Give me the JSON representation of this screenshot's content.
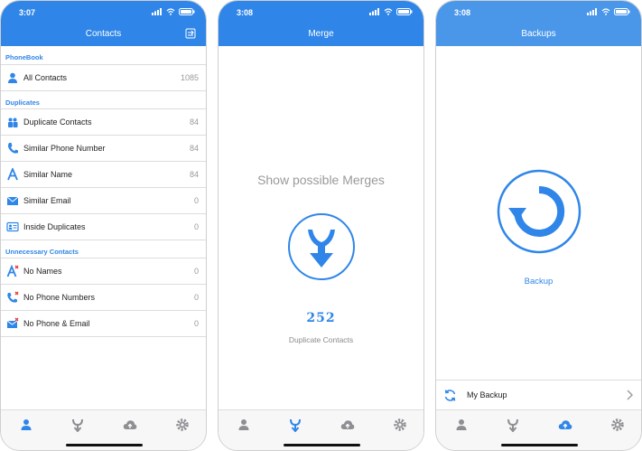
{
  "colors": {
    "accent": "#2f86e8",
    "accent_light": "#4a97ea",
    "tab_inactive": "#8e8e93"
  },
  "screen1": {
    "time": "3:07",
    "title": "Contacts",
    "sections": [
      {
        "header": "PhoneBook",
        "rows": [
          {
            "label": "All Contacts",
            "count": "1085",
            "icon": "person-icon"
          }
        ]
      },
      {
        "header": "Duplicates",
        "rows": [
          {
            "label": "Duplicate Contacts",
            "count": "84",
            "icon": "duplicate-people-icon"
          },
          {
            "label": "Similar Phone Number",
            "count": "84",
            "icon": "phone-icon"
          },
          {
            "label": "Similar Name",
            "count": "84",
            "icon": "letter-a-icon"
          },
          {
            "label": "Similar Email",
            "count": "0",
            "icon": "envelope-icon"
          },
          {
            "label": "Inside Duplicates",
            "count": "0",
            "icon": "contact-card-icon"
          }
        ]
      },
      {
        "header": "Unnecessary Contacts",
        "rows": [
          {
            "label": "No Names",
            "count": "0",
            "icon": "letter-a-x-icon"
          },
          {
            "label": "No Phone Numbers",
            "count": "0",
            "icon": "phone-x-icon"
          },
          {
            "label": "No Phone & Email",
            "count": "0",
            "icon": "envelope-x-icon"
          }
        ]
      }
    ]
  },
  "screen2": {
    "time": "3:08",
    "title": "Merge",
    "prompt": "Show possible Merges",
    "count": "252",
    "count_label": "Duplicate Contacts"
  },
  "screen3": {
    "time": "3:08",
    "title": "Backups",
    "action_label": "Backup",
    "list_item": "My Backup"
  },
  "tabs": [
    "contacts-tab",
    "merge-tab",
    "backup-tab",
    "settings-tab"
  ]
}
